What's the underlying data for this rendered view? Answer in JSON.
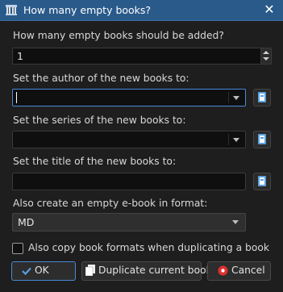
{
  "window": {
    "title": "How many empty books?",
    "app_icon": "library-icon",
    "close_icon": "close-icon"
  },
  "count": {
    "label": "How many empty books should be added?",
    "value": "1"
  },
  "author": {
    "label": "Set the author of the new books to:",
    "value": ""
  },
  "series": {
    "label": "Set the series of the new books to:",
    "value": ""
  },
  "title_field": {
    "label": "Set the title of the new books to:",
    "value": ""
  },
  "format": {
    "label": "Also create an empty e-book in format:",
    "selected": "MD"
  },
  "copy_formats": {
    "label": "Also copy book formats when duplicating a book",
    "checked": false
  },
  "buttons": {
    "ok": {
      "label": "OK",
      "icon": "check-icon"
    },
    "duplicate": {
      "label": "Duplicate current book",
      "icon": "book-copy-icon"
    },
    "cancel": {
      "label": "Cancel",
      "icon": "stop-icon"
    }
  },
  "colors": {
    "accent": "#4a8ad8",
    "titlebar": "#2a5a8a",
    "background": "#1e1e1e"
  }
}
